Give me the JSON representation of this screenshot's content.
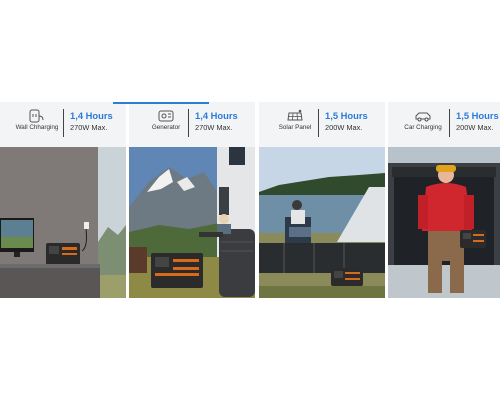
{
  "cards": [
    {
      "icon": "wall-outlet-icon",
      "label": "Wall Chharging",
      "hours": "1,4 Hours",
      "power": "270W Max."
    },
    {
      "icon": "generator-icon",
      "label": "Generator",
      "hours": "1,4 Hours",
      "power": "270W Max."
    },
    {
      "icon": "solar-panel-icon",
      "label": "Solar Panel",
      "hours": "1,5 Hours",
      "power": "200W Max."
    },
    {
      "icon": "car-icon",
      "label": "Car Charging",
      "hours": "1,5 Hours",
      "power": "200W Max."
    }
  ],
  "colors": {
    "accent": "#2b7ad8",
    "header_bg": "#f3f4f6",
    "divider": "#444444"
  }
}
